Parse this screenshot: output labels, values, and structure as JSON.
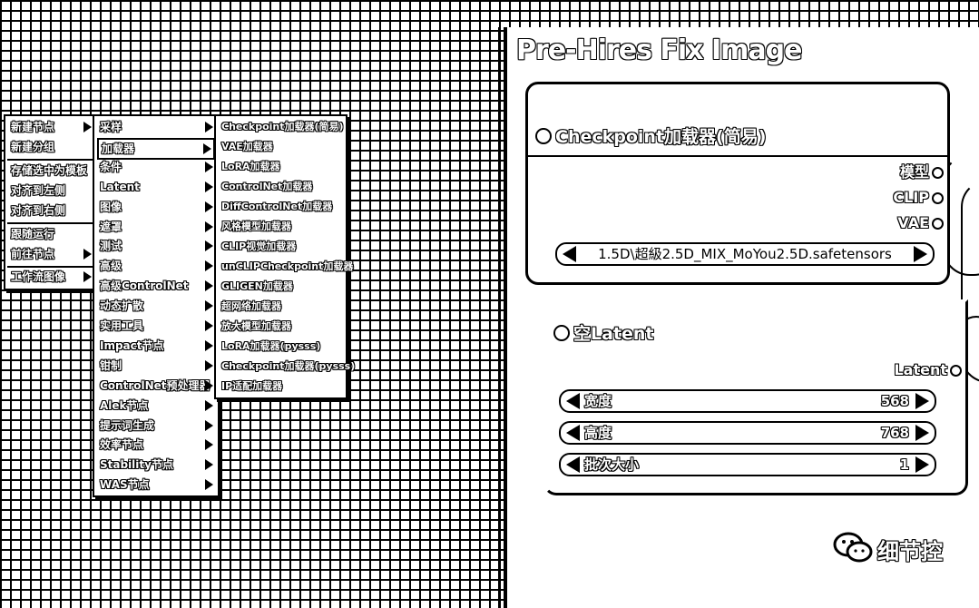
{
  "canvas_menu": {
    "items": [
      {
        "label": "新建节点",
        "submenu": true
      },
      {
        "label": "新建分组",
        "submenu": false
      },
      {
        "label": "存储选中为模板",
        "submenu": false
      },
      {
        "label": "对齐到左侧",
        "submenu": false
      },
      {
        "label": "对齐到右侧",
        "submenu": false
      },
      {
        "label": "跟随运行",
        "submenu": false
      },
      {
        "label": "前往节点",
        "submenu": true
      },
      {
        "label": "工作流图像",
        "submenu": true
      }
    ]
  },
  "category_menu": {
    "items": [
      "采样",
      "加载器",
      "条件",
      "Latent",
      "图像",
      "遮罩",
      "测试",
      "高级",
      "高级ControlNet",
      "动态扩散",
      "实用工具",
      "Impact节点",
      "钳制",
      "ControlNet预处理器",
      "Alek节点",
      "提示词生成",
      "效率节点",
      "Stability节点",
      "WAS节点"
    ],
    "selected": "加载器"
  },
  "loader_menu": {
    "items": [
      "Checkpoint加载器(简易)",
      "VAE加载器",
      "LoRA加载器",
      "ControlNet加载器",
      "DiffControlNet加载器",
      "风格模型加载器",
      "CLIP视觉加载器",
      "unCLIPCheckpoint加载器",
      "GLIGEN加载器",
      "超网络加载器",
      "放大模型加载器",
      "LoRA加载器(pysss)",
      "Checkpoint加载器(pysss)",
      "IP适配加载器"
    ]
  },
  "group": {
    "title": "Pre-Hires Fix Image"
  },
  "checkpoint_node": {
    "title": "Checkpoint加载器(简易)",
    "outputs": [
      "模型",
      "CLIP",
      "VAE"
    ],
    "ckpt_value": "1.5D\\超級2.5D_MIX_MoYou2.5D.safetensors"
  },
  "latent_node": {
    "title": "空Latent",
    "output": "Latent",
    "widgets": [
      {
        "label": "宽度",
        "value": "568"
      },
      {
        "label": "高度",
        "value": "768"
      },
      {
        "label": "批次大小",
        "value": "1"
      }
    ]
  },
  "watermark": {
    "text": "细节控",
    "icon": "wechat-icon"
  }
}
